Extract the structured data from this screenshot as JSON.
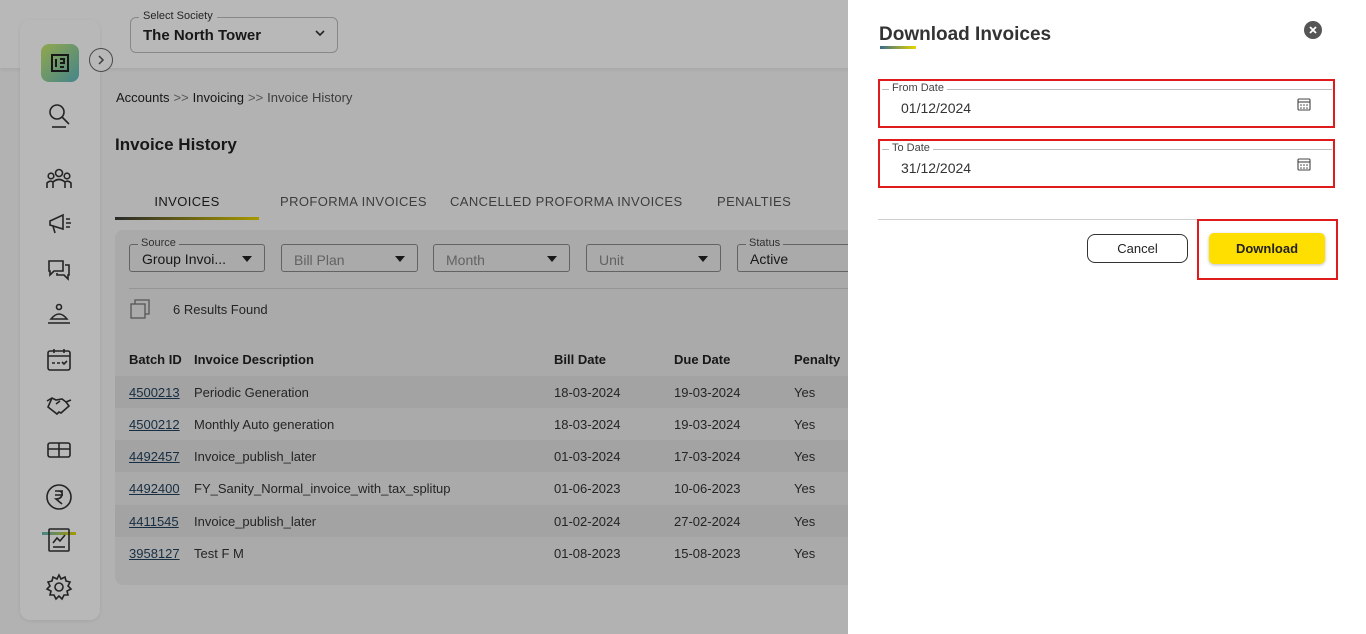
{
  "header": {
    "society_label": "Select Society",
    "society_value": "The North Tower"
  },
  "breadcrumb": {
    "items": [
      "Accounts",
      "Invoicing",
      "Invoice History"
    ],
    "separator": ">>"
  },
  "page_title": "Invoice History",
  "tabs": [
    {
      "label": "INVOICES",
      "active": true
    },
    {
      "label": "PROFORMA INVOICES",
      "active": false
    },
    {
      "label": "CANCELLED PROFORMA INVOICES",
      "active": false
    },
    {
      "label": "PENALTIES",
      "active": false
    }
  ],
  "filters": {
    "source": {
      "label": "Source",
      "value": "Group Invoi..."
    },
    "bill_plan": {
      "placeholder": "Bill Plan"
    },
    "month": {
      "placeholder": "Month"
    },
    "unit": {
      "placeholder": "Unit"
    },
    "status": {
      "label": "Status",
      "value": "Active"
    }
  },
  "results_text": "6 Results Found",
  "table": {
    "columns": [
      "Batch ID",
      "Invoice Description",
      "Bill Date",
      "Due Date",
      "Penalty"
    ],
    "rows": [
      [
        "4500213",
        "Periodic Generation",
        "18-03-2024",
        "19-03-2024",
        "Yes"
      ],
      [
        "4500212",
        "Monthly Auto generation",
        "18-03-2024",
        "19-03-2024",
        "Yes"
      ],
      [
        "4492457",
        "Invoice_publish_later",
        "01-03-2024",
        "17-03-2024",
        "Yes"
      ],
      [
        "4492400",
        "FY_Sanity_Normal_invoice_with_tax_splitup",
        "01-06-2023",
        "10-06-2023",
        "Yes"
      ],
      [
        "4411545",
        "Invoice_publish_later",
        "01-02-2024",
        "27-02-2024",
        "Yes"
      ],
      [
        "3958127",
        "Test F M",
        "01-08-2023",
        "15-08-2023",
        "Yes"
      ]
    ]
  },
  "dialog": {
    "title": "Download Invoices",
    "from_date": {
      "label": "From Date",
      "value": "01/12/2024"
    },
    "to_date": {
      "label": "To Date",
      "value": "31/12/2024"
    },
    "cancel_label": "Cancel",
    "download_label": "Download"
  },
  "colors": {
    "accent_yellow": "#ffdf00",
    "highlight_red": "#e01b1b",
    "link": "#1f3f5c"
  },
  "icons": [
    "logo-icon",
    "expand-sidebar-icon",
    "search-icon",
    "people-icon",
    "announcement-icon",
    "chat-icon",
    "service-icon",
    "calendar-icon",
    "handshake-icon",
    "amenity-icon",
    "rupee-icon",
    "report-icon",
    "settings-icon",
    "chevron-down-icon",
    "copy-icon",
    "close-icon",
    "calendar-picker-icon"
  ]
}
